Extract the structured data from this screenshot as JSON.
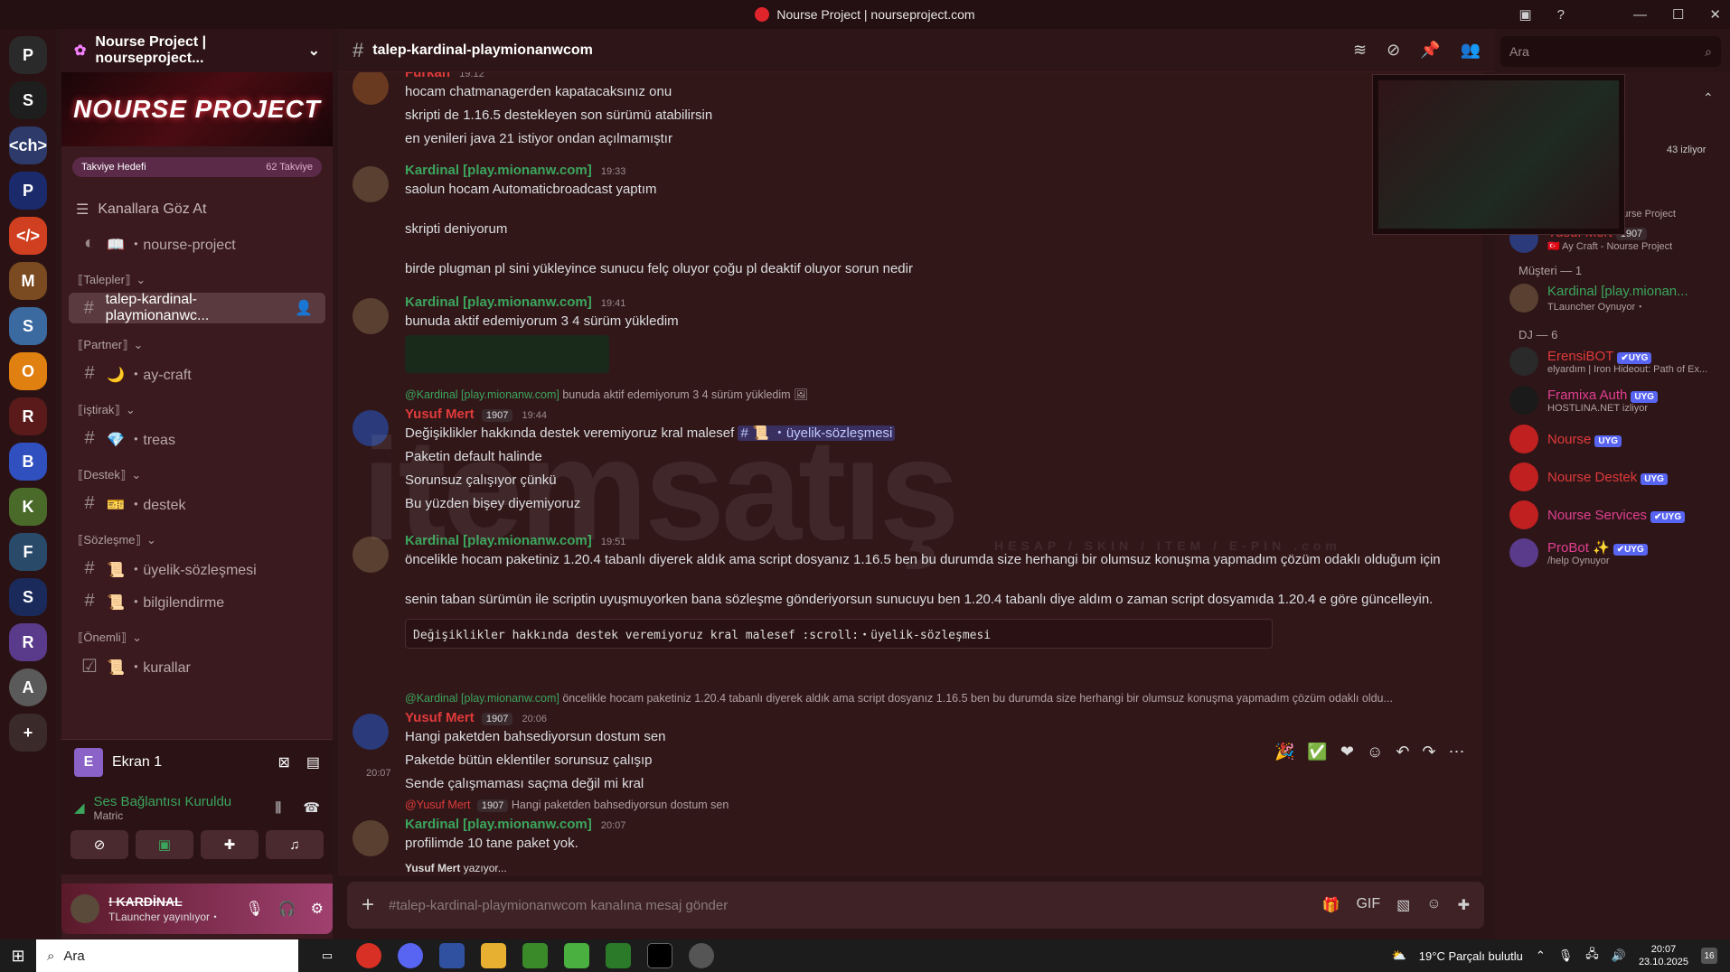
{
  "window": {
    "title": "Nourse Project | nourseproject.com"
  },
  "rail": {
    "servers": [
      "P",
      "S",
      "<ch>",
      "P",
      "</>",
      "M",
      "S",
      "O",
      "R",
      "B",
      "K",
      "F",
      "S",
      "R",
      "A",
      "+",
      "E"
    ]
  },
  "server": {
    "name": "Nourse Project | nourseproject...",
    "banner_text": "NOURSE PROJECT",
    "boost_label": "Takviye Hedefi",
    "boost_count": "62 Takviye",
    "browse_label": "Kanallara Göz At"
  },
  "channels": [
    {
      "type": "plain",
      "label": "📖 ・nourse-project"
    },
    {
      "type": "cat",
      "label": "⟦Talepler⟧"
    },
    {
      "type": "active",
      "label": "talep-kardinal-playmionanwc..."
    },
    {
      "type": "cat",
      "label": "⟦Partner⟧"
    },
    {
      "type": "hash",
      "label": "🌙 ・ay-craft"
    },
    {
      "type": "cat",
      "label": "⟦iştirak⟧"
    },
    {
      "type": "hash",
      "label": "💎 ・treas"
    },
    {
      "type": "cat",
      "label": "⟦Destek⟧"
    },
    {
      "type": "hash",
      "label": "🎫 ・destek"
    },
    {
      "type": "cat",
      "label": "⟦Sözleşme⟧"
    },
    {
      "type": "hash",
      "label": "📜 ・üyelik-sözleşmesi"
    },
    {
      "type": "hash",
      "label": "📜 ・bilgilendirme"
    },
    {
      "type": "cat",
      "label": "⟦Önemli⟧"
    },
    {
      "type": "check",
      "label": "📜 ・kurallar"
    }
  ],
  "voice": {
    "screen_label": "Ekran 1",
    "connected_label": "Ses Bağlantısı Kuruldu",
    "connected_sub": "Matric"
  },
  "user": {
    "name": "! KARDİNAL",
    "status": "TLauncher yayınlıyor・"
  },
  "chat_header": {
    "channel": "talep-kardinal-playmionanwcom",
    "search_placeholder": "Ara"
  },
  "messages": {
    "m1": {
      "name": "Furkan",
      "time": "19:12",
      "lines": [
        "hocam chatmanagerden kapatacaksınız onu",
        "skripti de 1.16.5 destekleyen son sürümü atabilirsin",
        "en yenileri java 21 istiyor ondan açılmamıştır"
      ]
    },
    "m2": {
      "name": "Kardinal [play.mionanw.com]",
      "time": "19:33",
      "lines": [
        "saolun hocam Automaticbroadcast yaptım",
        "skripti deniyorum",
        "birde plugman pl sini yükleyince sunucu felç oluyor çoğu pl deaktif oluyor sorun nedir"
      ]
    },
    "m3": {
      "name": "Kardinal [play.mionanw.com]",
      "time": "19:41",
      "lines": [
        "bunuda aktif edemiyorum 3 4 sürüm yükledim"
      ]
    },
    "m4": {
      "reply_name": "@Kardinal [play.mionanw.com]",
      "reply_text": "bunuda aktif edemiyorum 3 4 sürüm yükledim",
      "name": "Yusuf Mert",
      "badge": "1907",
      "time": "19:44",
      "lines": [
        "Değişiklikler hakkında destek veremiyoruz kral malesef",
        "Paketin default halinde",
        "Sorunsuz çalışıyor çünkü",
        "Bu yüzden bişey diyemiyoruz"
      ],
      "channel_mention": "📜 ・üyelik-sözleşmesi"
    },
    "m5": {
      "name": "Kardinal [play.mionanw.com]",
      "time": "19:51",
      "lines": [
        "öncelikle hocam paketiniz 1.20.4 tabanlı diyerek aldık ama script dosyanız 1.16.5 ben bu durumda size herhangi bir olumsuz konuşma yapmadım çözüm odaklı olduğum için",
        "senin taban sürümün ile scriptin uyuşmuyorken bana sözleşme gönderiyorsun sunucuyu ben 1.20.4 tabanlı diye aldım o zaman script dosyamıda 1.20.4 e göre güncelleyin."
      ],
      "code": "Değişiklikler hakkında destek veremiyoruz kral malesef :scroll:・üyelik-sözleşmesi"
    },
    "m6": {
      "reply_name": "@Kardinal [play.mionanw.com]",
      "reply_text": "öncelikle hocam paketiniz 1.20.4 tabanlı diyerek aldık ama script dosyanız 1.16.5 ben bu durumda size herhangi bir olumsuz konuşma yapmadım çözüm odaklı oldu...",
      "name": "Yusuf Mert",
      "badge": "1907",
      "time": "20:06",
      "lines": [
        "Hangi paketden bahsediyorsun dostum sen",
        "Paketde bütün eklentiler sorunsuz çalışıp",
        "Sende çalışmaması saçma değil mi kral"
      ],
      "hover_time": "20:07"
    },
    "m7": {
      "reply_name": "@Yusuf Mert",
      "reply_badge": "1907",
      "reply_text": "Hangi paketden bahsediyorsun dostum sen",
      "name": "Kardinal [play.mionanw.com]",
      "time": "20:07",
      "lines": [
        "profilimde 10 tane paket yok."
      ]
    }
  },
  "typing": {
    "name": "Yusuf Mert",
    "suffix": "yazıyor..."
  },
  "composer": {
    "placeholder": "#talep-kardinal-playmionanwcom kanalına mesaj gönder"
  },
  "members": {
    "stream_count": "43 izliyor",
    "top": [
      {
        "name": "Furkan",
        "status": "🇹🇷 Ay Craft & Nourse Project",
        "color": "#e03a3a"
      },
      {
        "name": "Yusuf Mert",
        "badge": "1907",
        "status": "🇹🇷 Ay Craft - Nourse Project",
        "color": "#e03a3a"
      }
    ],
    "group_customers": "Müşteri — 1",
    "customer": {
      "name": "Kardinal [play.mionan...",
      "status": "TLauncher Oynuyor・"
    },
    "group_dj": "DJ — 6",
    "dj": [
      {
        "name": "ErensiBOT",
        "tag": "✔UYG",
        "status": "elyardım | Iron Hideout: Path of Ex...",
        "color": "#e03a3a"
      },
      {
        "name": "Framixa Auth",
        "tag": "UYG",
        "status": "HOSTLINA.NET izliyor",
        "color": "#e04090"
      },
      {
        "name": "Nourse",
        "tag": "UYG",
        "status": "",
        "color": "#e03a3a"
      },
      {
        "name": "Nourse Destek",
        "tag": "UYG",
        "status": "",
        "color": "#e03a3a"
      },
      {
        "name": "Nourse Services",
        "tag": "✔UYG",
        "status": "",
        "color": "#e04090"
      },
      {
        "name": "ProBot ✨",
        "tag": "✔UYG",
        "status": "/help Oynuyor",
        "color": "#e04090"
      }
    ]
  },
  "watermark": {
    "text": "itemsatış",
    "sub": "HESAP / SKIN / ITEM / E-PIN .com"
  },
  "taskbar": {
    "search": "Ara",
    "weather": "19°C  Parçalı bulutlu",
    "time": "20:07",
    "date": "23.10.2025",
    "notif": "16"
  }
}
